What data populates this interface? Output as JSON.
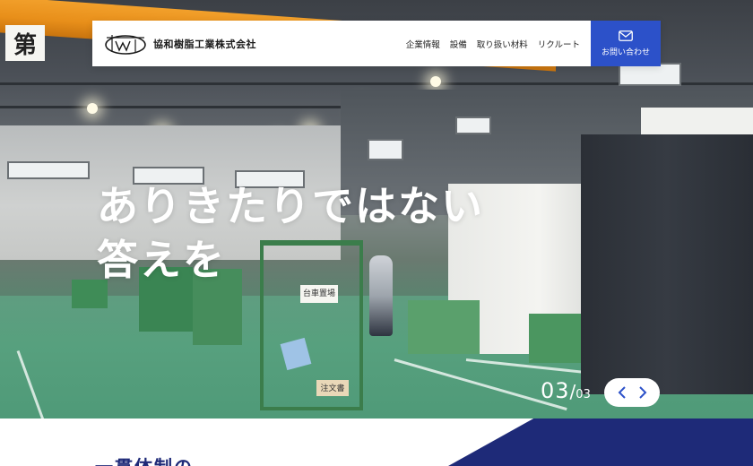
{
  "header": {
    "company_name": "協和樹脂工業株式会社",
    "logo_icon": "company-logo-mark",
    "nav": [
      "企業情報",
      "設備",
      "取り扱い材料",
      "リクルート"
    ],
    "contact_label": "お問い合わせ",
    "contact_icon": "mail-icon"
  },
  "hero": {
    "headline_line1": "ありきたりではない",
    "headline_line2": "答えを",
    "slide_current": "03",
    "slide_separator": "/",
    "slide_total": "03",
    "prev_icon": "chevron-left-icon",
    "next_icon": "chevron-right-icon",
    "crane_sign": "第",
    "sign_storage": "台車置場",
    "sign_order": "注文書"
  },
  "section": {
    "title": "一貫体制の"
  },
  "colors": {
    "accent_blue": "#2c51c9",
    "navy": "#1e2a78",
    "white": "#ffffff"
  }
}
